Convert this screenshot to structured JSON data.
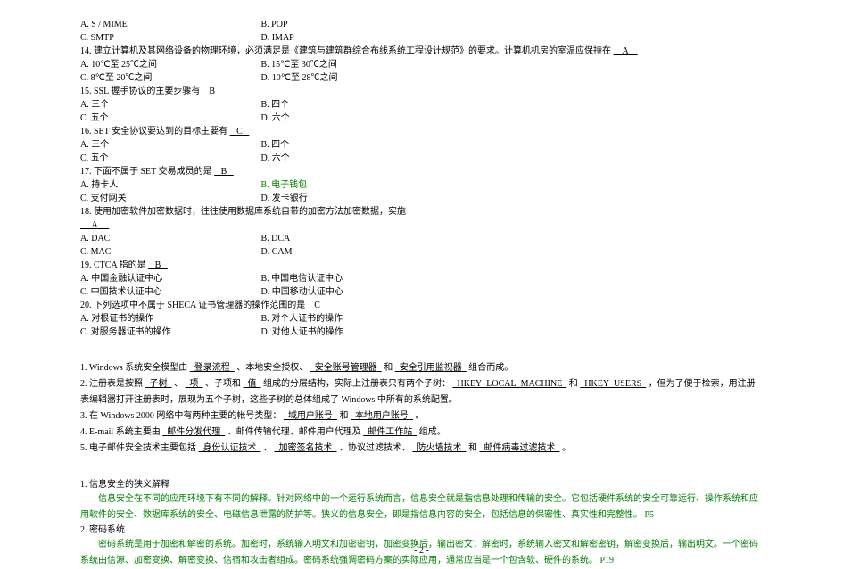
{
  "q_top": {
    "a": "A.  S / MIME",
    "b": "B.  POP",
    "c": "C.  SMTP",
    "d": "D.  IMAP"
  },
  "q14": {
    "stem_pre": "14.  建立计算机及其网络设备的物理环境，必须满足是《建筑与建筑群综合布线系统工程设计规范》的要求。计算机机房的室温应保持在",
    "ans": "A",
    "stem_post": "",
    "a": "A.  10℃至 25℃之间",
    "b": "B.  15℃至 30℃之间",
    "c": "C.  8℃至 20℃之间",
    "d": "D.  10℃至 28℃之间"
  },
  "q15": {
    "stem_pre": "15.  SSL 握手协议的主要步骤有",
    "ans": "B",
    "a": "A.  三个",
    "b": "B.  四个",
    "c": "C.  五个",
    "d": "D.  六个"
  },
  "q16": {
    "stem_pre": "16.  SET 安全协议要达到的目标主要有",
    "ans": "C",
    "a": "A.  三个",
    "b": "B.  四个",
    "c": "C.  五个",
    "d": "D.  六个"
  },
  "q17": {
    "stem_pre": "17.  下面不属于 SET 交易成员的是",
    "ans": "B",
    "a": "A.  持卡人",
    "b": "B.  电子钱包",
    "c": "C.  支付网关",
    "d": "D.  发卡银行"
  },
  "q18": {
    "stem": "18.  使用加密软件加密数据时，往往使用数据库系统自带的加密方法加密数据，实施",
    "ans": "A",
    "a": "A.  DAC",
    "b": "B.  DCA",
    "c": "C.  MAC",
    "d": "D.  CAM"
  },
  "q19": {
    "stem_pre": "19.  CTCA 指的是",
    "ans": "B",
    "a": "A.  中国金融认证中心",
    "b": "B.  中国电信认证中心",
    "c": "C.  中国技术认证中心",
    "d": "D.  中国移动认证中心"
  },
  "q20": {
    "stem_pre": "20.  下列选项中不属于 SHECA 证书管理器的操作范围的是",
    "ans": "C",
    "a": "A.  对根证书的操作",
    "b": "B.  对个人证书的操作",
    "c": "C.  对服务器证书的操作",
    "d": "D.  对他人证书的操作"
  },
  "fill": {
    "f1_pre": "1.  Windows 系统安全模型由",
    "f1_a": "登录流程",
    "f1_m1": "、本地安全授权、",
    "f1_b": "安全账号管理器",
    "f1_m2": " 和 ",
    "f1_c": "安全引用监视器",
    "f1_post": " 组合而成。",
    "f2_pre": "2.  注册表是按照",
    "f2_a": "子树",
    "f2_m1": "、",
    "f2_b": "项",
    "f2_m2": "、子项和",
    "f2_c": "值",
    "f2_m3": "组成的分层结构，实际上注册表只有两个子树：",
    "f2_d": "HKEY_LOCAL_MACHINE",
    "f2_m4": " 和 ",
    "f2_e": "HKEY_USERS",
    "f2_post": "，但为了便于检索，用注册表编辑器打开注册表时，展现为五个子树，这些子树的总体组成了 Windows 中所有的系统配置。",
    "f3_pre": "3.  在 Windows 2000  网络中有两种主要的帐号类型：",
    "f3_a": "域用户账号",
    "f3_m": " 和 ",
    "f3_b": "本地用户账号",
    "f3_post": " 。",
    "f4_pre": "4.  E-mail 系统主要由",
    "f4_a": "邮件分发代理",
    "f4_m": "、邮件传输代理、邮件用户代理及",
    "f4_b": "邮件工作站",
    "f4_post": " 组成。",
    "f5_pre": "5.  电子邮件安全技术主要包括",
    "f5_a": "身份认证技术",
    "f5_m1": "、",
    "f5_b": "加密签名技术",
    "f5_m2": "、协议过滤技术、",
    "f5_c": "防火墙技术",
    "f5_m3": "和",
    "f5_d": "邮件病毒过滤技术",
    "f5_post": " 。"
  },
  "essay1": {
    "title": "1.  信息安全的狭义解释",
    "body": "信息安全在不同的应用环境下有不同的解释。针对网络中的一个运行系统而言，信息安全就是指信息处理和传输的安全。它包括硬件系统的安全可靠运行、操作系统和应用软件的安全、数据库系统的安全、电磁信息泄露的防护等。狭义的信息安全，即是指信息内容的安全，包括信息的保密性、真实性和完整性。 P5"
  },
  "essay2": {
    "title": "2.  密码系统",
    "body": "密码系统是用于加密和解密的系统。加密时，系统输入明文和加密密钥，加密变换后，输出密文；解密时，系统输入密文和解密密钥，解密变换后，输出明文。一个密码系统由信源、加密变换、解密变换、信宿和攻击者组成。密码系统强调密码方案的实际应用，通常应当是一个包含软、硬件的系统。 P19"
  },
  "page_num": "- 2 -"
}
